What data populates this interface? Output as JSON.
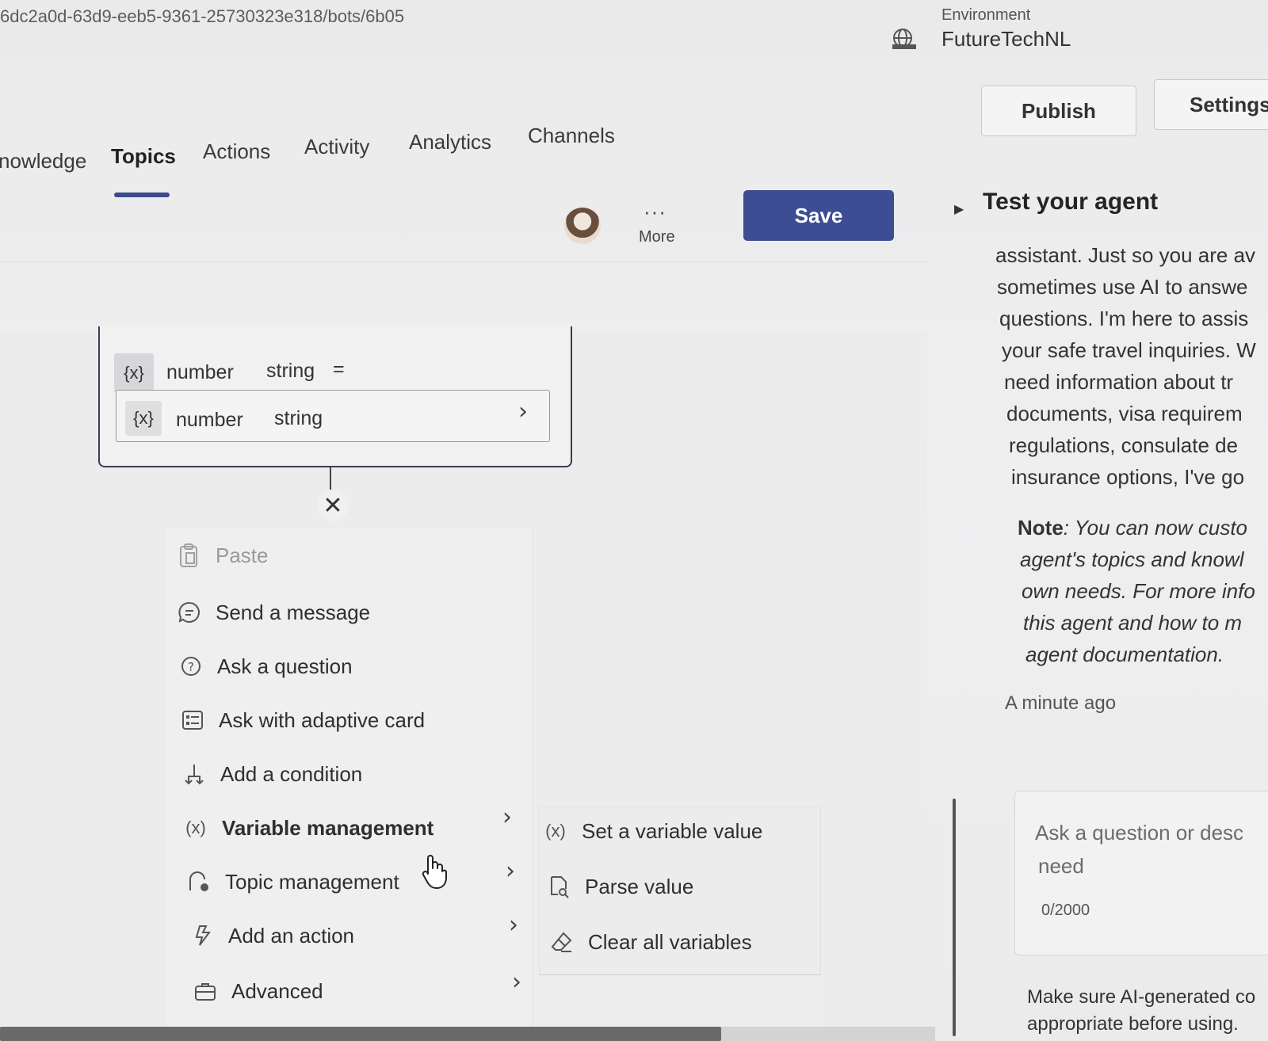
{
  "topbar": {
    "url_fragment": "6dc2a0d-63d9-eeb5-9361-25730323e318/bots/6b05",
    "environment_label": "Environment",
    "environment_name": "FutureTechNL",
    "publish_label": "Publish",
    "settings_label": "Settings"
  },
  "nav": {
    "tabs": [
      {
        "label": "nowledge"
      },
      {
        "label": "Topics",
        "active": true
      },
      {
        "label": "Actions"
      },
      {
        "label": "Activity"
      },
      {
        "label": "Analytics"
      },
      {
        "label": "Channels"
      }
    ]
  },
  "toolbar": {
    "more_dots": "···",
    "more_label": "More",
    "save_label": "Save"
  },
  "node": {
    "row1": {
      "chip": "{x}",
      "name": "number",
      "type": "string",
      "op": "="
    },
    "row2": {
      "chip": "{x}",
      "name": "number",
      "type": "string"
    },
    "close_glyph": "✕"
  },
  "menu": {
    "items": [
      {
        "label": "Paste",
        "icon": "clipboard-icon",
        "disabled": true
      },
      {
        "label": "Send a message",
        "icon": "message-icon"
      },
      {
        "label": "Ask a question",
        "icon": "question-icon"
      },
      {
        "label": "Ask with adaptive card",
        "icon": "adaptive-card-icon"
      },
      {
        "label": "Add a condition",
        "icon": "branch-icon"
      },
      {
        "label": "Variable management",
        "icon": "variable-icon",
        "submenu": true
      },
      {
        "label": "Topic management",
        "icon": "topic-icon",
        "submenu": true
      },
      {
        "label": "Add an action",
        "icon": "action-icon",
        "submenu": true
      },
      {
        "label": "Advanced",
        "icon": "briefcase-icon",
        "submenu": true
      }
    ],
    "submenu": [
      {
        "label": "Set a variable value",
        "icon": "variable-icon"
      },
      {
        "label": "Parse value",
        "icon": "parse-icon"
      },
      {
        "label": "Clear all variables",
        "icon": "eraser-icon"
      }
    ]
  },
  "test_panel": {
    "title": "Test your agent",
    "message_lines": [
      "assistant. Just so you are av",
      "sometimes use AI to answe",
      "questions. I'm here to assis",
      "your safe travel inquiries. W",
      "need information about tr",
      "documents, visa requirem",
      "regulations, consulate de",
      "insurance options, I've go"
    ],
    "note_bold": "Note",
    "note_lines": [
      ": You can now custo",
      "agent's topics and knowl",
      "own needs. For more info",
      "this agent and how to m",
      "agent documentation."
    ],
    "timestamp": "A minute ago",
    "input_placeholder_lines": [
      "Ask a question or desc",
      "need"
    ],
    "char_count": "0/2000",
    "disclaimer_lines": [
      "Make sure AI-generated co",
      "appropriate before using."
    ]
  },
  "colors": {
    "accent": "#3c4d94",
    "background": "#ededee",
    "node_border": "#3b3b55"
  }
}
